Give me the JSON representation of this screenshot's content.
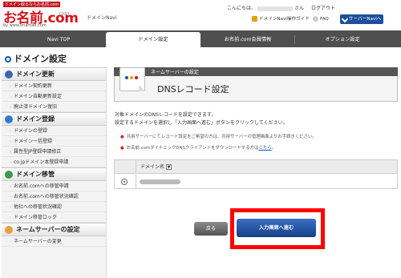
{
  "header": {
    "logo_tag": "ドメイン取るならお名前.com",
    "logo_main": "お名前.com",
    "logo_sub": "GMO",
    "logo_url": "by www.onamae.com",
    "domain_navi": "ドメインNavi",
    "greeting_prefix": "こんにちは、",
    "greeting_suffix": "さん",
    "logout": "ログアウト",
    "guide_button": "ドメインNavi操作ガイド",
    "faq_button": "FAQ",
    "server_navi_button": "サーバーNaviへ"
  },
  "nav": {
    "tabs": [
      {
        "label": "Navi TOP"
      },
      {
        "label": "ドメイン設定"
      },
      {
        "label": "お名前.com会員情報"
      },
      {
        "label": "オプション設定"
      }
    ]
  },
  "sidebar": {
    "page_title": "ドメイン設定",
    "sections": [
      {
        "title": "ドメイン更新",
        "items": [
          "ドメイン契約更新",
          "ドメイン自動更新設定",
          "廃止済ドメイン復旧"
        ]
      },
      {
        "title": "ドメイン登録",
        "items": [
          "ドメインの登録",
          "ドメイン一括登録",
          "属性型JP登録申請修正",
          "co.jpドメイン本登録申請"
        ]
      },
      {
        "title": "ドメイン移管",
        "items": [
          "お名前.comへの移管申請",
          "お名前.comへの移管状況確認",
          "他社への移管状況確認",
          "ドメイン移管ロック"
        ]
      },
      {
        "title": "ネームサーバーの設定",
        "items": [
          "ネームサーバーの変更"
        ]
      }
    ]
  },
  "main": {
    "panel_header": "ネームサーバーの設定",
    "panel_title": "DNSレコード設定",
    "desc_line1": "対象ドメインのDNSレコードを設定できます。",
    "desc_line2": "設定するドメインを選択し「入力画面へ進む」ボタンをクリックしてください。",
    "note1": "共用サーバーにてレコード設定をご希望の方は、共用サーバーの管理画面よりお手続きください。",
    "note2_text": "お名前.comダイナミックDNSクライアントをダウンロードする方は",
    "note2_link": "こちら",
    "note2_end": "。",
    "table_col_domain": "ドメイン名",
    "sort_icon": "▼",
    "back_button": "戻る",
    "proceed_button": "入力画面へ進む"
  }
}
